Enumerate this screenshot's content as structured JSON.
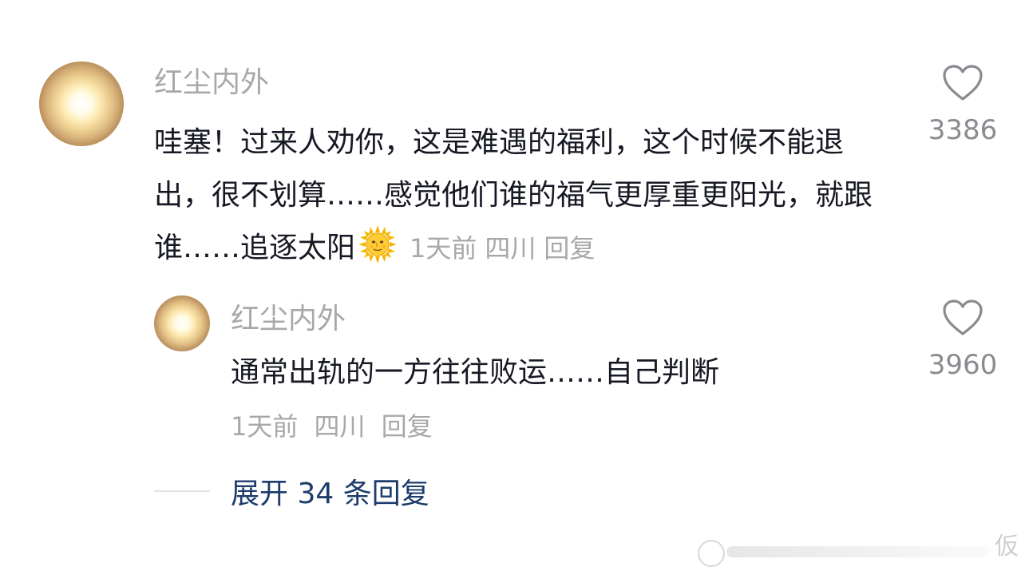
{
  "comment": {
    "username": "红尘内外",
    "text": "哇塞！过来人劝你，这是难遇的福利，这个时候不能退出，很不划算……感觉他们谁的福气更厚重更阳光，就跟谁……追逐太阳",
    "emoji": "sun-with-face",
    "time": "1天前",
    "location": "四川",
    "reply_label": "回复",
    "likes": "3386"
  },
  "reply": {
    "username": "红尘内外",
    "text": "通常出轨的一方往往败运……自己判断",
    "time": "1天前",
    "location": "四川",
    "reply_label": "回复",
    "likes": "3960"
  },
  "expand": {
    "label": "展开 34 条回复"
  },
  "watermark": {
    "text": "仮"
  },
  "colors": {
    "text_primary": "#161823",
    "text_secondary": "#a7a8ab",
    "link": "#1c3c6b"
  }
}
